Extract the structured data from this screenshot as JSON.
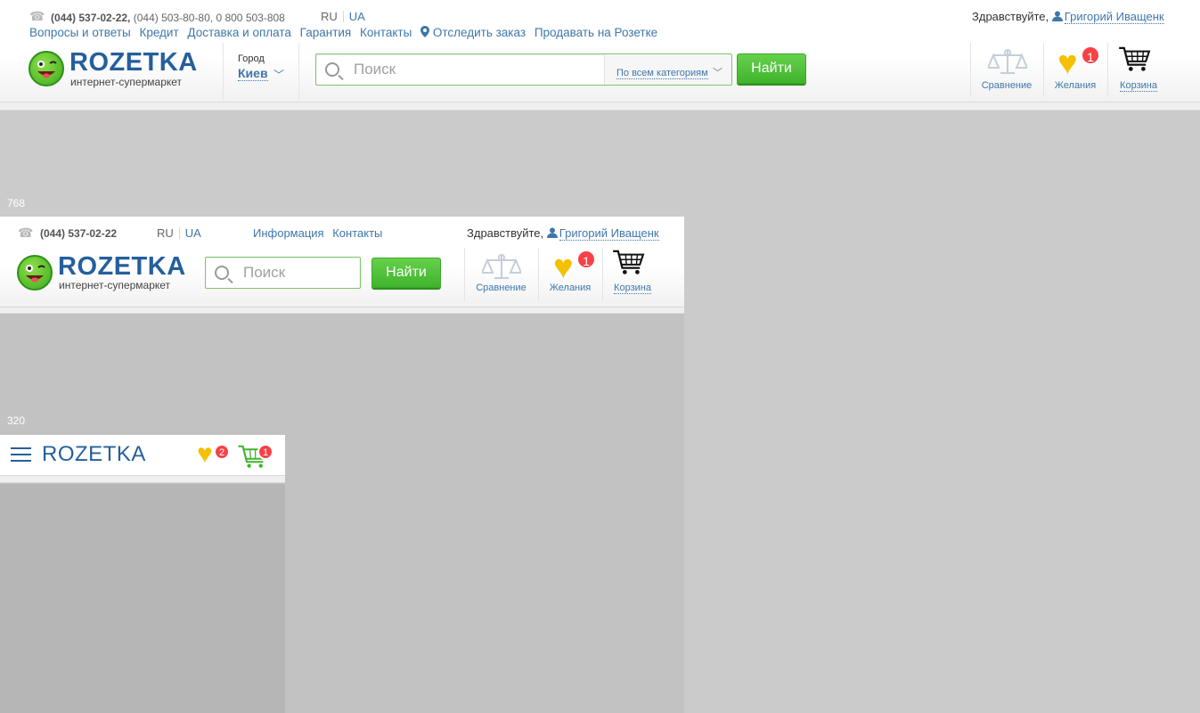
{
  "desktop": {
    "phone_main": "(044) 537-02-22,",
    "phone_rest": " (044) 503-80-80, 0 800 503-808",
    "lang_ru": "RU",
    "lang_ua": "UA",
    "nav": [
      "Вопросы и ответы",
      "Кредит",
      "Доставка и оплата",
      "Гарантия",
      "Контакты",
      "Отследить заказ",
      "Продавать на Розетке"
    ],
    "greeting": "Здравствуйте,",
    "user_name": "Григорий Иващенк",
    "logo_word": "ROZETKA",
    "logo_sub": "интернет-супермаркет",
    "city_label": "Город",
    "city_value": "Киев",
    "search_placeholder": "Поиск",
    "search_category": "По всем категориям",
    "find_button": "Найти",
    "compare_label": "Сравнение",
    "wishlist_label": "Желания",
    "wishlist_count": "1",
    "cart_label": "Корзина"
  },
  "tablet": {
    "breakpoint": "768",
    "phone_main": "(044) 537-02-22",
    "lang_ru": "RU",
    "lang_ua": "UA",
    "nav": [
      "Информация",
      "Контакты"
    ],
    "greeting": "Здравствуйте,",
    "user_name": "Григорий Иващенк",
    "logo_word": "ROZETKA",
    "logo_sub": "интернет-супермаркет",
    "search_placeholder": "Поиск",
    "find_button": "Найти",
    "compare_label": "Сравнение",
    "wishlist_label": "Желания",
    "wishlist_count": "1",
    "cart_label": "Корзина"
  },
  "mobile": {
    "breakpoint": "320",
    "logo_word": "ROZETKA",
    "wishlist_count": "2",
    "cart_count": "1"
  },
  "colors": {
    "link": "#3e77aa",
    "brand": "#255f9c",
    "button": "#4cbd36",
    "badge": "#f84147",
    "heart": "#f4c000"
  }
}
